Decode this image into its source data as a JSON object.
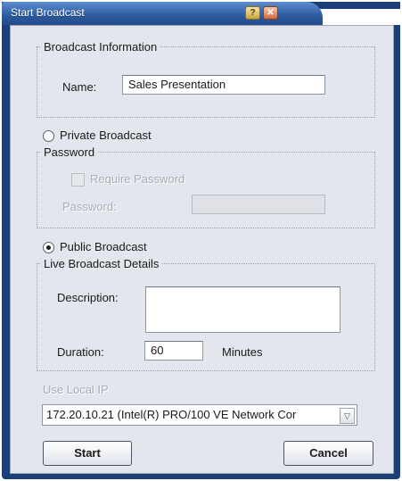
{
  "window": {
    "title": "Start Broadcast",
    "help_glyph": "?",
    "close_glyph": "✕"
  },
  "broadcast_info": {
    "legend": "Broadcast Information",
    "name_label": "Name:",
    "name_value": "Sales Presentation"
  },
  "private": {
    "radio_label": "Private Broadcast",
    "selected": false,
    "password_legend": "Password",
    "require_password_label": "Require Password",
    "password_label": "Password:",
    "password_value": ""
  },
  "public": {
    "radio_label": "Public Broadcast",
    "selected": true,
    "details_legend": "Live Broadcast Details",
    "description_label": "Description:",
    "description_value": "",
    "duration_label": "Duration:",
    "duration_value": "60",
    "minutes_label": "Minutes"
  },
  "local_ip": {
    "label": "Use Local IP",
    "selected_value": "172.20.10.21 (Intel(R) PRO/100 VE Network Cor",
    "arrow_glyph": "▽"
  },
  "buttons": {
    "start": "Start",
    "cancel": "Cancel"
  },
  "colors": {
    "title_bar": "#2c5a9e",
    "frame": "#1d3f78",
    "panel": "#e3e6ec"
  }
}
